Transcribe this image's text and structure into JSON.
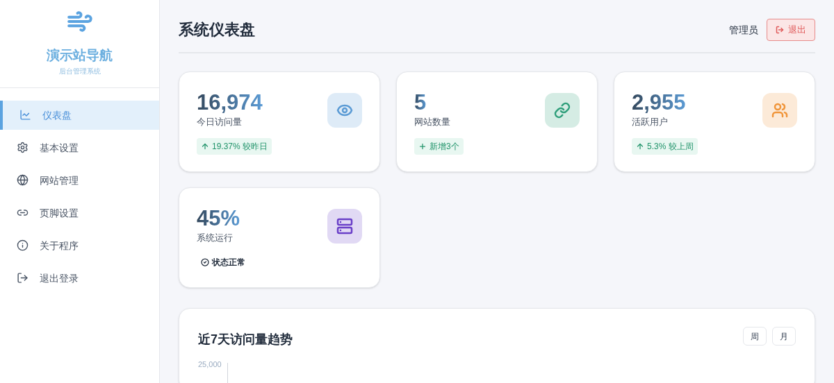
{
  "sidebar": {
    "brand": {
      "title": "演示站导航",
      "subtitle": "后台管理系统"
    },
    "items": [
      {
        "label": "仪表盘",
        "kind": "chart",
        "selected": true
      },
      {
        "label": "基本设置",
        "kind": "gear",
        "selected": false
      },
      {
        "label": "网站管理",
        "kind": "globe",
        "selected": false
      },
      {
        "label": "页脚设置",
        "kind": "link",
        "selected": false
      },
      {
        "label": "关于程序",
        "kind": "info",
        "selected": false
      },
      {
        "label": "退出登录",
        "kind": "logout",
        "selected": false
      }
    ]
  },
  "header": {
    "title": "系统仪表盘",
    "user": "管理员",
    "logout_button": "退出"
  },
  "stats": [
    {
      "value": "16,974",
      "label": "今日访问量",
      "kind": "eye",
      "color": "#5b9bd5",
      "badge": {
        "kind": "up",
        "text": "19.37% 较昨日"
      }
    },
    {
      "value": "5",
      "label": "网站数量",
      "kind": "link",
      "color": "#2e9e7a",
      "badge": {
        "kind": "plus",
        "text": "新增3个"
      }
    },
    {
      "value": "2,955",
      "label": "活跃用户",
      "kind": "users",
      "color": "#f0953a",
      "badge": {
        "kind": "up",
        "text": "5.3% 较上周"
      }
    },
    {
      "value": "45%",
      "label": "系统运行",
      "kind": "server",
      "color": "#6a3fc8",
      "badge": {
        "kind": "check",
        "text": "状态正常"
      }
    }
  ],
  "chart_panel": {
    "title": "近7天访问量趋势",
    "range_buttons": [
      "周",
      "月"
    ],
    "y_tick_label": "25,000"
  }
}
